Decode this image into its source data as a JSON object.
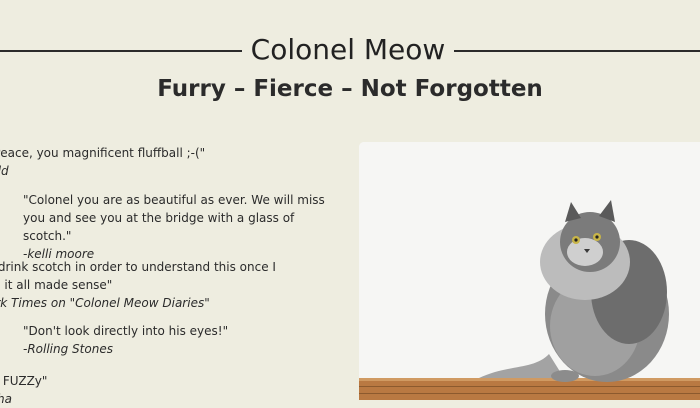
{
  "header": {
    "title": "Colonel Meow",
    "subtitle": "Furry – Fierce – Not Forgotten"
  },
  "quotes": [
    {
      "text": "n Peace, you magnificent fluffball ;-(\"",
      "author": "Cold"
    },
    {
      "text": "\"Colonel you are as beautiful as ever. We will miss you and see you at the bridge with a glass of scotch.\"",
      "author": "-kelli moore"
    },
    {
      "text": "to drink scotch in order to understand this once I did it all made sense\"",
      "author": "York Times on \"Colonel Meow Diaries\""
    },
    {
      "text": "\"Don't look directly into his eyes!\"",
      "author": "-Rolling Stones"
    },
    {
      "text": "SO FUZZy\"",
      "author": "ueha"
    }
  ],
  "photo": {
    "subject": "long-haired grey cat sitting on a wooden table",
    "colors": {
      "background": "#f6f6f4",
      "fur": "#8c8c8c",
      "table": "#b97942"
    }
  }
}
